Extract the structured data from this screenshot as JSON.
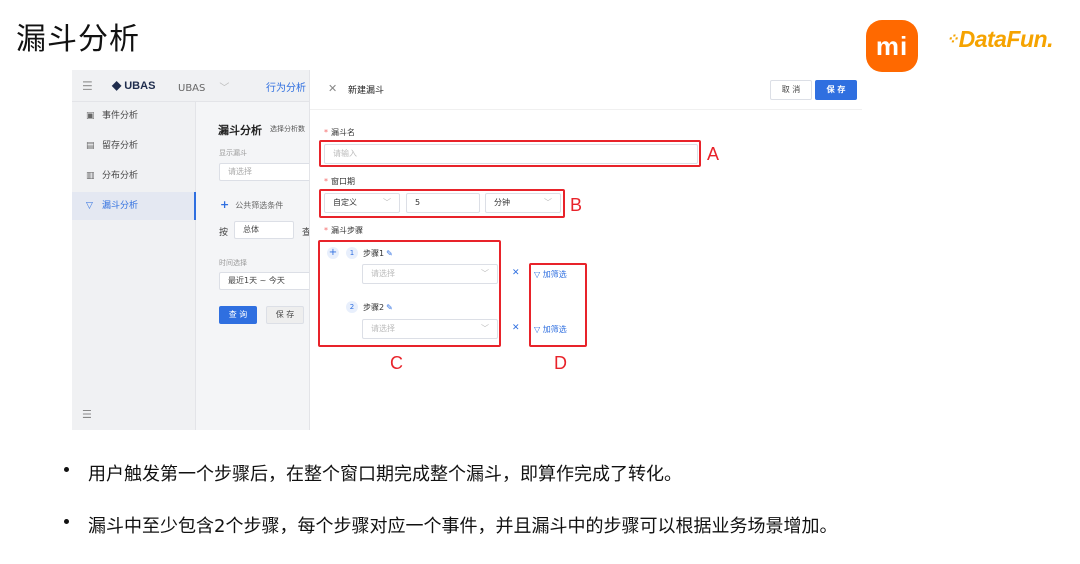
{
  "slide": {
    "title": "漏斗分析",
    "logo_mi": "mi",
    "logo_datafun": "DataFun."
  },
  "app": {
    "brand": "UBAS",
    "project_select": "UBAS",
    "top_menu": "行为分析",
    "sidebar": {
      "items": [
        {
          "label": "事件分析",
          "icon": "event-icon"
        },
        {
          "label": "留存分析",
          "icon": "retention-icon"
        },
        {
          "label": "分布分析",
          "icon": "distribution-icon"
        },
        {
          "label": "漏斗分析",
          "icon": "funnel-icon",
          "active": true
        }
      ]
    },
    "background_panel": {
      "title": "漏斗分析",
      "subtitle": "选择分析数",
      "show_funnel_label": "显示漏斗",
      "show_funnel_placeholder": "请选择",
      "common_filter": "公共筛选条件",
      "by_label": "按",
      "by_value": "总体",
      "by_suffix": "查",
      "time_label": "时间选择",
      "time_value": "最近1天 ~ 今天",
      "query_button": "查 询",
      "save_button": "保 存"
    }
  },
  "modal": {
    "title": "新建漏斗",
    "cancel": "取 消",
    "save": "保 存",
    "fields": {
      "name_label": "漏斗名",
      "name_placeholder": "请输入",
      "window_label": "窗口期",
      "window_type": "自定义",
      "window_value": "5",
      "window_unit": "分钟",
      "steps_label": "漏斗步骤"
    },
    "steps": [
      {
        "index": "1",
        "name": "步骤1",
        "placeholder": "请选择",
        "filter": "加筛选"
      },
      {
        "index": "2",
        "name": "步骤2",
        "placeholder": "请选择",
        "filter": "加筛选"
      }
    ]
  },
  "annotations": {
    "A": "A",
    "B": "B",
    "C": "C",
    "D": "D",
    "color": "#e8232a"
  },
  "bullets": [
    "用户触发第一个步骤后，在整个窗口期完成整个漏斗，即算作完成了转化。",
    "漏斗中至少包含2个步骤，每个步骤对应一个事件，并且漏斗中的步骤可以根据业务场景增加。"
  ],
  "colors": {
    "accent": "#2f6fe0",
    "mi_orange": "#ff6900",
    "datafun_yellow": "#f5a300"
  }
}
